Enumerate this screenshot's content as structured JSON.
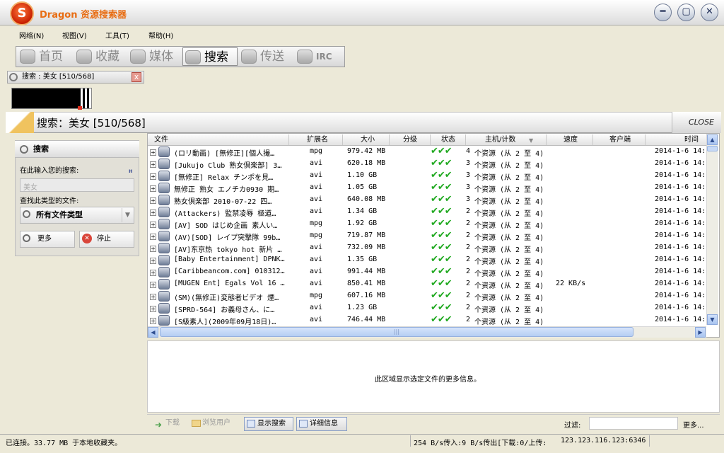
{
  "app": {
    "title": "Dragon 资源搜索器",
    "logo_letter": "S"
  },
  "window_buttons": {
    "minimize": "━",
    "maximize": "▢",
    "close": "✕"
  },
  "menu": [
    "网络(N)",
    "视图(V)",
    "工具(T)",
    "帮助(H)"
  ],
  "toolbar": [
    {
      "label": "首页",
      "icon": "home-icon",
      "active": false
    },
    {
      "label": "收藏",
      "icon": "folder-icon",
      "active": false
    },
    {
      "label": "媒体",
      "icon": "film-reel-icon",
      "active": false
    },
    {
      "label": "搜索",
      "icon": "magnifier-icon",
      "active": true
    },
    {
      "label": "传送",
      "icon": "transfer-icon",
      "active": false
    },
    {
      "label": "IRC",
      "icon": "chat-people-icon",
      "active": false
    }
  ],
  "search_tab": {
    "label": "搜索 : 美女 [510/568]",
    "close": "x"
  },
  "header": {
    "title": "搜索：美女 [510/568]",
    "close": "CLOSE"
  },
  "left_panel": {
    "title": "搜索",
    "prompt": "在此输入您的搜索:",
    "keyword_placeholder": "美女",
    "type_label": "查找此类型的文件:",
    "type_value": "所有文件类型",
    "more_button": "更多",
    "stop_button": "停止"
  },
  "columns": [
    "文件",
    "扩展名",
    "大小",
    "分级",
    "状态",
    "主机/计数",
    "速度",
    "客户端",
    "时间"
  ],
  "rows": [
    {
      "file": "(ロリ動画) [無修正][個人撮…",
      "ext": "mpg",
      "size": "979.42 MB",
      "count": "4",
      "host": "个资源 (从 2 至 4)",
      "speed": "",
      "time": "2014-1-6 14:"
    },
    {
      "file": "[Jukujo Club 熟女倶楽部] 3…",
      "ext": "avi",
      "size": "620.18 MB",
      "count": "3",
      "host": "个资源 (从 2 至 4)",
      "speed": "",
      "time": "2014-1-6 14:"
    },
    {
      "file": "[無修正] Relax チンポを見…",
      "ext": "avi",
      "size": "1.10 GB",
      "count": "3",
      "host": "个资源 (从 2 至 4)",
      "speed": "",
      "time": "2014-1-6 14:"
    },
    {
      "file": "無修正 熟女 エノチカ0930 期…",
      "ext": "avi",
      "size": "1.05 GB",
      "count": "3",
      "host": "个资源 (从 2 至 4)",
      "speed": "",
      "time": "2014-1-6 14:"
    },
    {
      "file": "熟女倶楽部 2010-07-22 四…",
      "ext": "avi",
      "size": "640.08 MB",
      "count": "3",
      "host": "个资源 (从 2 至 4)",
      "speed": "",
      "time": "2014-1-6 14:"
    },
    {
      "file": "(Attackers) 監禁凌辱 極道…",
      "ext": "avi",
      "size": "1.34 GB",
      "count": "2",
      "host": "个资源 (从 2 至 4)",
      "speed": "",
      "time": "2014-1-6 14:"
    },
    {
      "file": "[AV] SOD はじめ企画 素人い…",
      "ext": "mpg",
      "size": "1.92 GB",
      "count": "2",
      "host": "个资源 (从 2 至 4)",
      "speed": "",
      "time": "2014-1-6 14:"
    },
    {
      "file": "(AV)[SOD] レイプ突撃隊 99b…",
      "ext": "mpg",
      "size": "719.87 MB",
      "count": "2",
      "host": "个资源 (从 2 至 4)",
      "speed": "",
      "time": "2014-1-6 14:"
    },
    {
      "file": "[AV]东京热 tokyo hot 新片 …",
      "ext": "avi",
      "size": "732.09 MB",
      "count": "2",
      "host": "个资源 (从 2 至 4)",
      "speed": "",
      "time": "2014-1-6 14:"
    },
    {
      "file": "[Baby Entertainment] DPNK…",
      "ext": "avi",
      "size": "1.35 GB",
      "count": "2",
      "host": "个资源 (从 2 至 4)",
      "speed": "",
      "time": "2014-1-6 14:"
    },
    {
      "file": "[Caribbeancom.com] 010312…",
      "ext": "avi",
      "size": "991.44 MB",
      "count": "2",
      "host": "个资源 (从 2 至 4)",
      "speed": "",
      "time": "2014-1-6 14:"
    },
    {
      "file": "[MUGEN Ent] Egals Vol 16 …",
      "ext": "avi",
      "size": "850.41 MB",
      "count": "2",
      "host": "个资源 (从 2 至 4)",
      "speed": "22 KB/s",
      "time": "2014-1-6 14:"
    },
    {
      "file": "(SM)(無修正)変態者ビデオ 煙…",
      "ext": "mpg",
      "size": "607.16 MB",
      "count": "2",
      "host": "个资源 (从 2 至 4)",
      "speed": "",
      "time": "2014-1-6 14:"
    },
    {
      "file": "[SPRD-564] お義母さん、に…",
      "ext": "avi",
      "size": "1.23 GB",
      "count": "2",
      "host": "个资源 (从 2 至 4)",
      "speed": "",
      "time": "2014-1-6 14:"
    },
    {
      "file": "[S級素人](2009年09月18日)…",
      "ext": "avi",
      "size": "746.44 MB",
      "count": "2",
      "host": "个资源 (从 2 至 4)",
      "speed": "",
      "time": "2014-1-6 14:"
    }
  ],
  "info_text": "此区域显示选定文件的更多信息。",
  "bottom_buttons": [
    {
      "label": "下载",
      "on": false
    },
    {
      "label": "浏览用户",
      "on": false
    },
    {
      "label": "显示搜索",
      "on": true
    },
    {
      "label": "详细信息",
      "on": true
    }
  ],
  "filter_label": "过滤:",
  "more_label": "更多...",
  "status": {
    "left": "已连接。33.77 MB 于本地收藏夹。",
    "mid": "254 B/s传入:9 B/s传出[下载:0/上传:",
    "ip": "123.123.116.123:6346"
  }
}
